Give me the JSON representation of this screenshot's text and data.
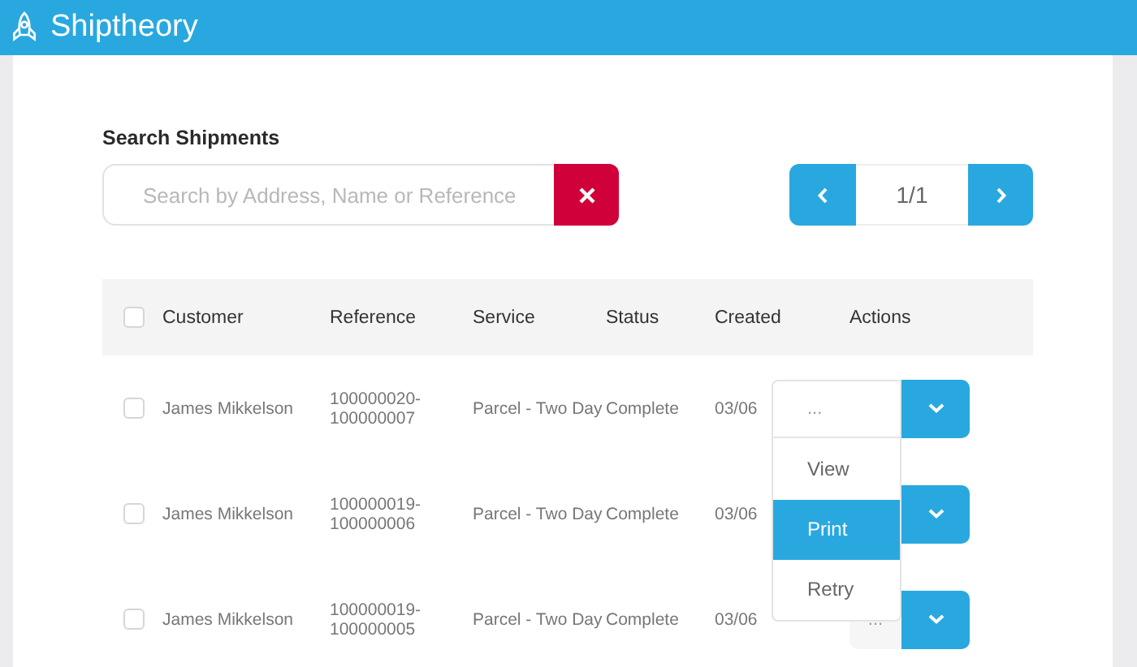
{
  "app": {
    "title": "Shiptheory"
  },
  "search": {
    "heading": "Search Shipments",
    "placeholder": "Search by Address, Name or Reference"
  },
  "pager": {
    "page": "1/1"
  },
  "table": {
    "select_all": {
      "checked": false
    },
    "columns": [
      {
        "label": "Customer"
      },
      {
        "label": "Reference"
      },
      {
        "label": "Service"
      },
      {
        "label": "Status"
      },
      {
        "label": "Created"
      },
      {
        "label": "Actions"
      }
    ],
    "rows": [
      {
        "checked": false,
        "customer": "James Mikkelson",
        "reference": "100000020-100000007",
        "service": "Parcel - Two Day",
        "status": "Complete",
        "created": "03/06",
        "action": {
          "value": "...",
          "open": true,
          "options": [
            {
              "label": "View",
              "selected": false
            },
            {
              "label": "Print",
              "selected": true
            },
            {
              "label": "Retry",
              "selected": false
            }
          ]
        }
      },
      {
        "checked": false,
        "customer": "James Mikkelson",
        "reference": "100000019-100000006",
        "service": "Parcel - Two Day",
        "status": "Complete",
        "created": "03/06",
        "action": {
          "open": false
        }
      },
      {
        "checked": false,
        "customer": "James Mikkelson",
        "reference": "100000019-100000005",
        "service": "Parcel - Two Day",
        "status": "Complete",
        "created": "03/06",
        "action": {
          "value": "...",
          "open": false
        }
      }
    ]
  }
}
